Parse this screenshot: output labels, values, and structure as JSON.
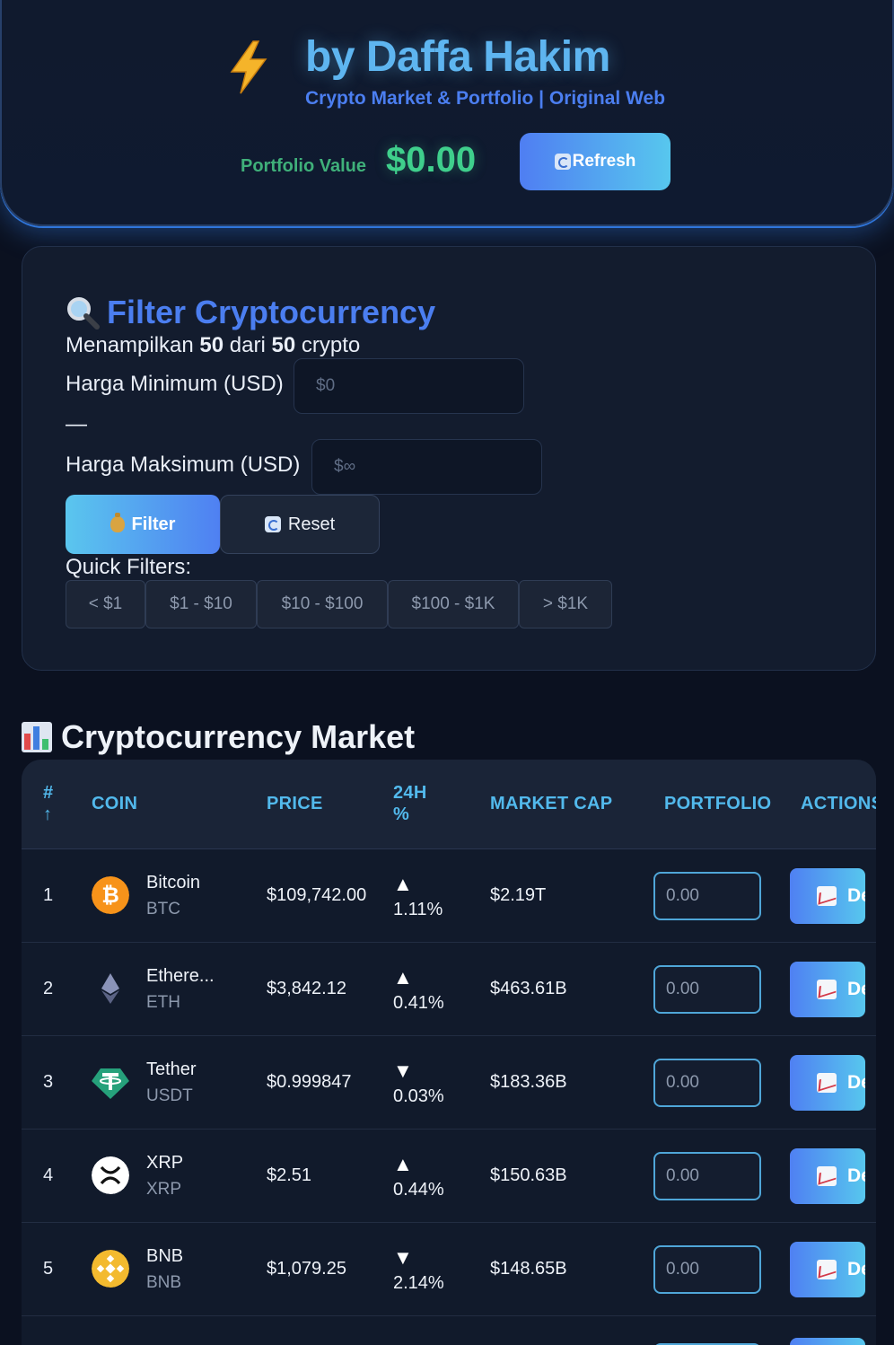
{
  "header": {
    "title": "by Daffa Hakim",
    "subtitle": "Crypto Market & Portfolio | Original Web",
    "portfolio_label": "Portfolio Value",
    "portfolio_value": "$0.00",
    "refresh_label": "Refresh",
    "accent_color": "#5eb5f0",
    "green_color": "#3fcf8c"
  },
  "filter": {
    "title": "Filter Cryptocurrency",
    "count_prefix": "Menampilkan",
    "count_shown": "50",
    "count_mid": "dari",
    "count_total": "50",
    "count_suffix": "crypto",
    "min_label": "Harga Minimum (USD)",
    "min_placeholder": "$0",
    "separator": "—",
    "max_label": "Harga Maksimum (USD)",
    "max_placeholder": "$∞",
    "filter_button": "Filter",
    "reset_button": "Reset",
    "quick_label": "Quick Filters:",
    "quick_filters": [
      "< $1",
      "$1 - $10",
      "$10 - $100",
      "$100 - $1K",
      "> $1K"
    ]
  },
  "market": {
    "title": "Cryptocurrency Market",
    "columns": {
      "rank": "#",
      "rank_sort": "↑",
      "coin": "COIN",
      "price": "PRICE",
      "change_line1": "24H",
      "change_line2": "%",
      "market_cap": "MARKET CAP",
      "portfolio": "PORTFOLIO",
      "actions": "ACTIONS"
    },
    "action_label": "De",
    "rows": [
      {
        "rank": "1",
        "name": "Bitcoin",
        "symbol": "BTC",
        "price": "$109,742.00",
        "direction": "▲",
        "change": "1.11%",
        "market_cap": "$2.19T",
        "portfolio_placeholder": "0.00",
        "icon": "bitcoin-icon",
        "icon_color": "#f7931a"
      },
      {
        "rank": "2",
        "name": "Ethere...",
        "symbol": "ETH",
        "price": "$3,842.12",
        "direction": "▲",
        "change": "0.41%",
        "market_cap": "$463.61B",
        "portfolio_placeholder": "0.00",
        "icon": "ethereum-icon",
        "icon_color": "#8a93b8"
      },
      {
        "rank": "3",
        "name": "Tether",
        "symbol": "USDT",
        "price": "$0.999847",
        "direction": "▼",
        "change": "0.03%",
        "market_cap": "$183.36B",
        "portfolio_placeholder": "0.00",
        "icon": "tether-icon",
        "icon_color": "#26a17b"
      },
      {
        "rank": "4",
        "name": "XRP",
        "symbol": "XRP",
        "price": "$2.51",
        "direction": "▲",
        "change": "0.44%",
        "market_cap": "$150.63B",
        "portfolio_placeholder": "0.00",
        "icon": "xrp-icon",
        "icon_color": "#ffffff"
      },
      {
        "rank": "5",
        "name": "BNB",
        "symbol": "BNB",
        "price": "$1,079.25",
        "direction": "▼",
        "change": "2.14%",
        "market_cap": "$148.65B",
        "portfolio_placeholder": "0.00",
        "icon": "bnb-icon",
        "icon_color": "#f3ba2f"
      }
    ]
  }
}
